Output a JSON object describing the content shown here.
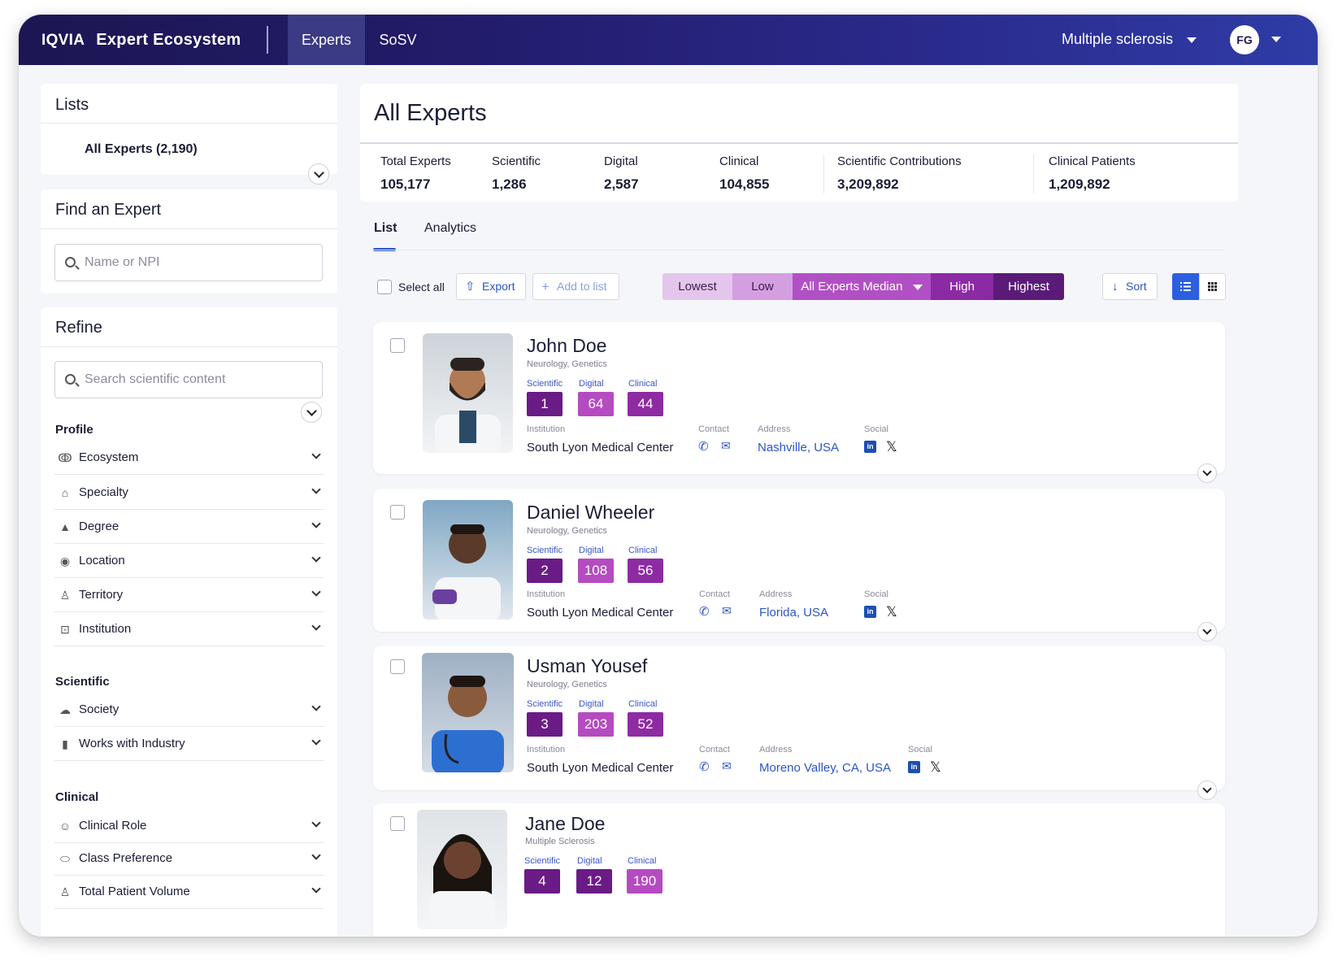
{
  "header": {
    "brand_iqvia": "IQVIA",
    "brand_name": "Expert Ecosystem",
    "tabs": [
      "Experts",
      "SoSV"
    ],
    "therapeutic_area": "Multiple sclerosis",
    "user_initials": "FG"
  },
  "lists": {
    "title": "Lists",
    "selected": "All Experts (2,190)"
  },
  "find": {
    "title": "Find an Expert",
    "placeholder": "Name or NPI"
  },
  "refine": {
    "title": "Refine",
    "placeholder": "Search scientific content",
    "sections": [
      {
        "title": "Profile",
        "items": [
          "Ecosystem",
          "Specialty",
          "Degree",
          "Location",
          "Territory",
          "Institution"
        ]
      },
      {
        "title": "Scientific",
        "items": [
          "Society",
          "Works with Industry"
        ]
      },
      {
        "title": "Clinical",
        "items": [
          "Clinical Role",
          "Class Preference",
          "Total Patient Volume"
        ]
      }
    ]
  },
  "main": {
    "title": "All Experts",
    "stats": [
      {
        "label": "Total Experts",
        "value": "105,177"
      },
      {
        "label": "Scientific",
        "value": "1,286"
      },
      {
        "label": "Digital",
        "value": "2,587"
      },
      {
        "label": "Clinical",
        "value": "104,855"
      },
      {
        "label": "Scientific Contributions",
        "value": "3,209,892"
      },
      {
        "label": "Clinical Patients",
        "value": "1,209,892"
      }
    ],
    "tabs": [
      "List",
      "Analytics"
    ],
    "toolbar": {
      "select_all": "Select all",
      "export": "Export",
      "add_to_list": "Add to list",
      "segments": [
        "Lowest",
        "Low",
        "All Experts Median",
        "High",
        "Highest"
      ],
      "sort": "Sort"
    },
    "field_labels": {
      "scientific": "Scientific",
      "digital": "Digital",
      "clinical": "Clinical",
      "institution": "Institution",
      "contact": "Contact",
      "address": "Address",
      "social": "Social"
    },
    "experts": [
      {
        "name": "John Doe",
        "specialty": "Neurology, Genetics",
        "scientific": "1",
        "digital": "64",
        "clinical": "44",
        "institution": "South Lyon Medical Center",
        "address": "Nashville, USA"
      },
      {
        "name": "Daniel Wheeler",
        "specialty": "Neurology, Genetics",
        "scientific": "2",
        "digital": "108",
        "clinical": "56",
        "institution": "South Lyon Medical Center",
        "address": "Florida, USA"
      },
      {
        "name": "Usman Yousef",
        "specialty": "Neurology, Genetics",
        "scientific": "3",
        "digital": "203",
        "clinical": "52",
        "institution": "South Lyon Medical Center",
        "address": "Moreno Valley, CA, USA"
      },
      {
        "name": "Jane Doe",
        "specialty": "Multiple Sclerosis",
        "scientific": "4",
        "digital": "12",
        "clinical": "190"
      }
    ]
  },
  "colors": {
    "header_start": "#1c1653",
    "header_end": "#2f3ca6",
    "accent_blue": "#2b55c7",
    "metric_scientific": "#6a1b86",
    "metric_digital": "#b54bc0",
    "metric_clinical": "#8e2aa2"
  }
}
